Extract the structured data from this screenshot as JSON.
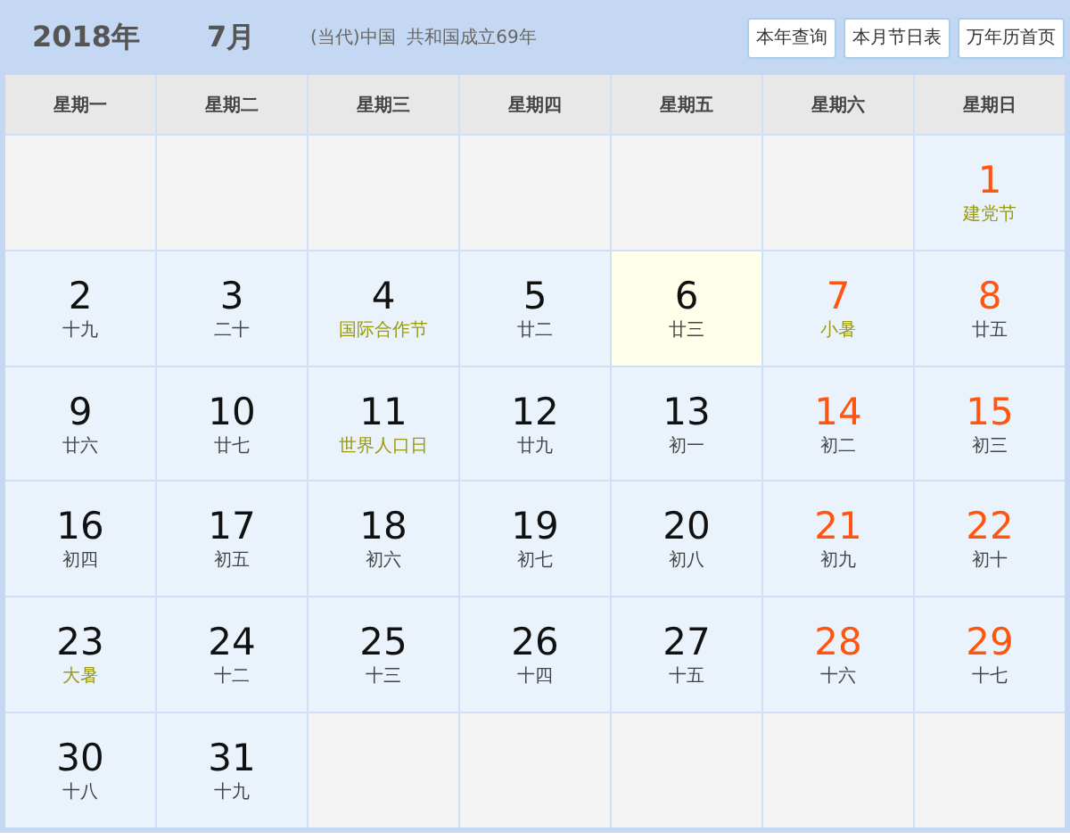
{
  "header": {
    "year": "2018年",
    "month": "7月",
    "note": "(当代)中国  共和国成立69年",
    "buttons": [
      "本年查询",
      "本月节日表",
      "万年历首页"
    ]
  },
  "weekdays": [
    "星期一",
    "星期二",
    "星期三",
    "星期四",
    "星期五",
    "星期六",
    "星期日"
  ],
  "days": [
    {
      "kind": "empty"
    },
    {
      "kind": "empty"
    },
    {
      "kind": "empty"
    },
    {
      "kind": "empty"
    },
    {
      "kind": "empty"
    },
    {
      "kind": "empty"
    },
    {
      "kind": "day",
      "number": "1",
      "lunar": "建党节",
      "weekend": true,
      "festival": true,
      "today": false
    },
    {
      "kind": "day",
      "number": "2",
      "lunar": "十九",
      "weekend": false,
      "festival": false,
      "today": false
    },
    {
      "kind": "day",
      "number": "3",
      "lunar": "二十",
      "weekend": false,
      "festival": false,
      "today": false
    },
    {
      "kind": "day",
      "number": "4",
      "lunar": "国际合作节",
      "weekend": false,
      "festival": true,
      "today": false
    },
    {
      "kind": "day",
      "number": "5",
      "lunar": "廿二",
      "weekend": false,
      "festival": false,
      "today": false
    },
    {
      "kind": "day",
      "number": "6",
      "lunar": "廿三",
      "weekend": false,
      "festival": false,
      "today": true
    },
    {
      "kind": "day",
      "number": "7",
      "lunar": "小暑",
      "weekend": true,
      "festival": true,
      "today": false
    },
    {
      "kind": "day",
      "number": "8",
      "lunar": "廿五",
      "weekend": true,
      "festival": false,
      "today": false
    },
    {
      "kind": "day",
      "number": "9",
      "lunar": "廿六",
      "weekend": false,
      "festival": false,
      "today": false
    },
    {
      "kind": "day",
      "number": "10",
      "lunar": "廿七",
      "weekend": false,
      "festival": false,
      "today": false
    },
    {
      "kind": "day",
      "number": "11",
      "lunar": "世界人口日",
      "weekend": false,
      "festival": true,
      "today": false
    },
    {
      "kind": "day",
      "number": "12",
      "lunar": "廿九",
      "weekend": false,
      "festival": false,
      "today": false
    },
    {
      "kind": "day",
      "number": "13",
      "lunar": "初一",
      "weekend": false,
      "festival": false,
      "today": false
    },
    {
      "kind": "day",
      "number": "14",
      "lunar": "初二",
      "weekend": true,
      "festival": false,
      "today": false
    },
    {
      "kind": "day",
      "number": "15",
      "lunar": "初三",
      "weekend": true,
      "festival": false,
      "today": false
    },
    {
      "kind": "day",
      "number": "16",
      "lunar": "初四",
      "weekend": false,
      "festival": false,
      "today": false
    },
    {
      "kind": "day",
      "number": "17",
      "lunar": "初五",
      "weekend": false,
      "festival": false,
      "today": false
    },
    {
      "kind": "day",
      "number": "18",
      "lunar": "初六",
      "weekend": false,
      "festival": false,
      "today": false
    },
    {
      "kind": "day",
      "number": "19",
      "lunar": "初七",
      "weekend": false,
      "festival": false,
      "today": false
    },
    {
      "kind": "day",
      "number": "20",
      "lunar": "初八",
      "weekend": false,
      "festival": false,
      "today": false
    },
    {
      "kind": "day",
      "number": "21",
      "lunar": "初九",
      "weekend": true,
      "festival": false,
      "today": false
    },
    {
      "kind": "day",
      "number": "22",
      "lunar": "初十",
      "weekend": true,
      "festival": false,
      "today": false
    },
    {
      "kind": "day",
      "number": "23",
      "lunar": "大暑",
      "weekend": false,
      "festival": true,
      "today": false
    },
    {
      "kind": "day",
      "number": "24",
      "lunar": "十二",
      "weekend": false,
      "festival": false,
      "today": false
    },
    {
      "kind": "day",
      "number": "25",
      "lunar": "十三",
      "weekend": false,
      "festival": false,
      "today": false
    },
    {
      "kind": "day",
      "number": "26",
      "lunar": "十四",
      "weekend": false,
      "festival": false,
      "today": false
    },
    {
      "kind": "day",
      "number": "27",
      "lunar": "十五",
      "weekend": false,
      "festival": false,
      "today": false
    },
    {
      "kind": "day",
      "number": "28",
      "lunar": "十六",
      "weekend": true,
      "festival": false,
      "today": false
    },
    {
      "kind": "day",
      "number": "29",
      "lunar": "十七",
      "weekend": true,
      "festival": false,
      "today": false
    },
    {
      "kind": "day",
      "number": "30",
      "lunar": "十八",
      "weekend": false,
      "festival": false,
      "today": false
    },
    {
      "kind": "day",
      "number": "31",
      "lunar": "十九",
      "weekend": false,
      "festival": false,
      "today": false
    },
    {
      "kind": "empty"
    },
    {
      "kind": "empty"
    },
    {
      "kind": "empty"
    },
    {
      "kind": "empty"
    },
    {
      "kind": "empty"
    }
  ]
}
